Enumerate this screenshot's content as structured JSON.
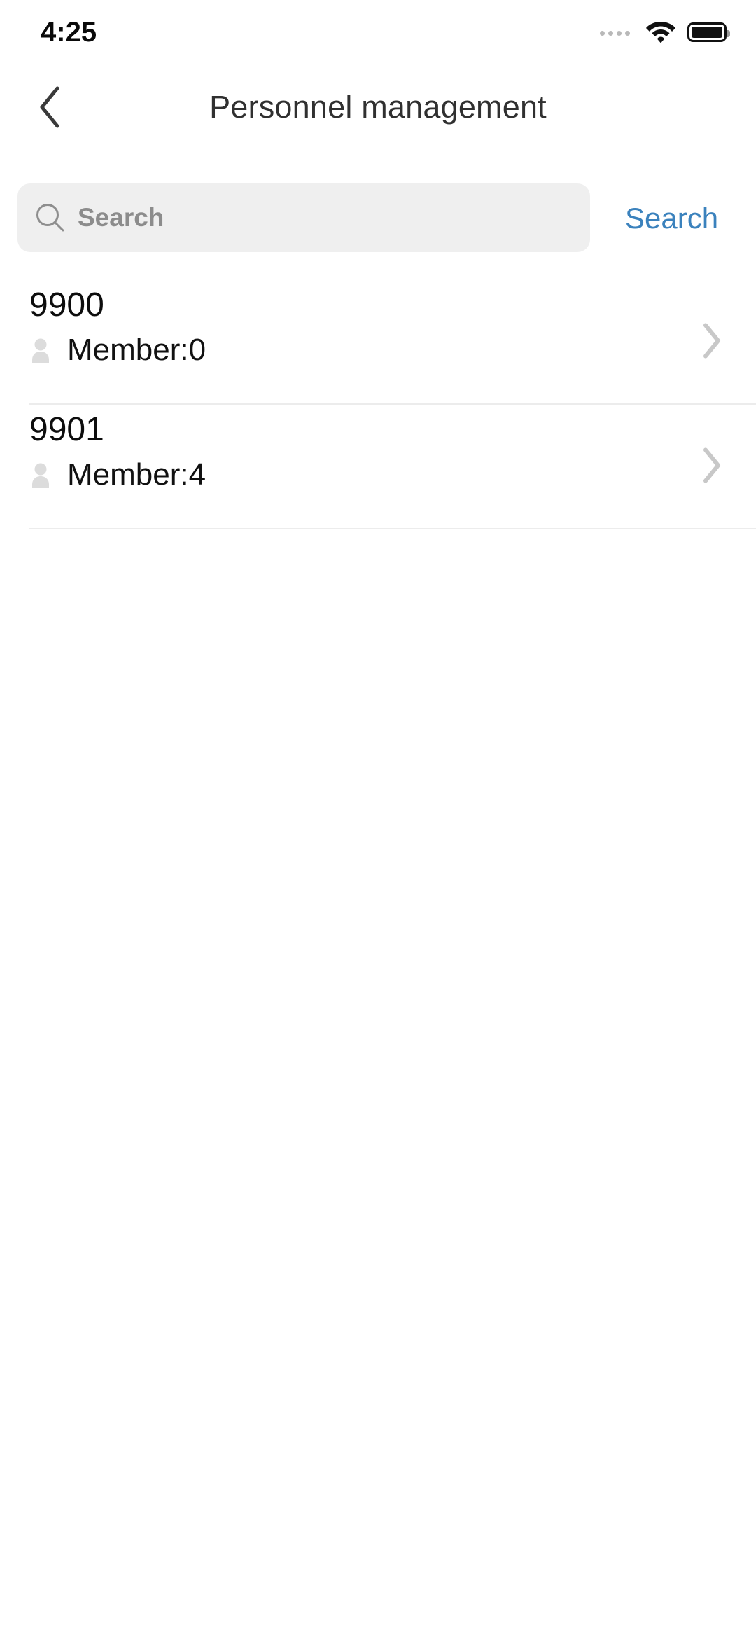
{
  "status_bar": {
    "time": "4:25",
    "signal_icon": "signal-dots-icon",
    "wifi_icon": "wifi-icon",
    "battery_icon": "battery-full-icon"
  },
  "navbar": {
    "back_icon": "chevron-left-icon",
    "title": "Personnel management"
  },
  "search": {
    "icon": "search-icon",
    "value": "",
    "placeholder": "Search",
    "button_label": "Search",
    "button_color": "#3b82bd",
    "field_background": "#efefef"
  },
  "list": {
    "rows": [
      {
        "title": "9900",
        "member_icon": "person-icon",
        "member_label": "Member:0",
        "chevron_icon": "chevron-right-icon"
      },
      {
        "title": "9901",
        "member_icon": "person-icon",
        "member_label": "Member:4",
        "chevron_icon": "chevron-right-icon"
      }
    ]
  },
  "colors": {
    "page_background": "#ffffff",
    "divider": "#ececec",
    "muted_gray": "#c8c8c8",
    "title_text": "#303030"
  }
}
